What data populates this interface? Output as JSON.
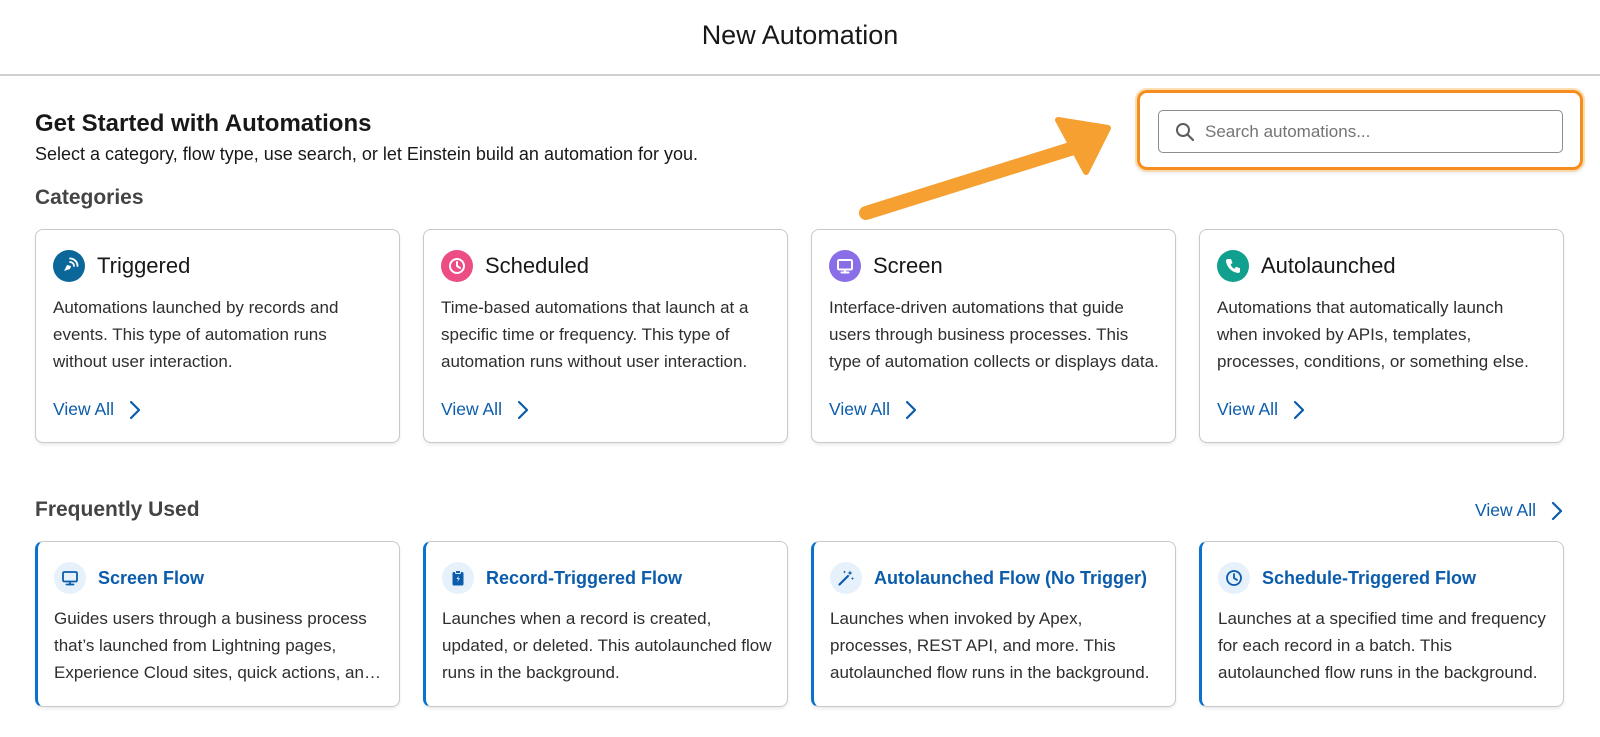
{
  "header": {
    "title": "New Automation"
  },
  "intro": {
    "title": "Get Started with Automations",
    "subtitle": "Select a category, flow type, use search, or let Einstein build an automation for you."
  },
  "search": {
    "placeholder": "Search automations..."
  },
  "colors": {
    "highlight": "#f58e1f",
    "link": "#0b5cab",
    "triggered": "#0b6699",
    "scheduled": "#ec4d85",
    "screen": "#8a6ee8",
    "autolaunched": "#12a08e"
  },
  "categories": {
    "title": "Categories",
    "items": [
      {
        "title": "Triggered",
        "icon": "signal-hand-icon",
        "description": "Automations launched by records and events. This type of automation runs without user interaction.",
        "link": "View All"
      },
      {
        "title": "Scheduled",
        "icon": "clock-icon",
        "description": "Time-based automations that launch at a specific time or frequency. This type of automation runs without user interaction.",
        "link": "View All"
      },
      {
        "title": "Screen",
        "icon": "monitor-icon",
        "description": "Interface-driven automations that guide users through business processes. This type of automation collects or displays data.",
        "link": "View All"
      },
      {
        "title": "Autolaunched",
        "icon": "phone-icon",
        "description": "Automations that automatically launch when invoked by APIs, templates, processes, conditions, or something else.",
        "link": "View All"
      }
    ]
  },
  "frequently_used": {
    "title": "Frequently Used",
    "view_all": "View All",
    "items": [
      {
        "title": "Screen Flow",
        "icon": "monitor-icon",
        "description": "Guides users through a business process that’s launched from Lightning pages, Experience Cloud sites, quick actions, and more."
      },
      {
        "title": "Record-Triggered Flow",
        "icon": "clipboard-icon",
        "description": "Launches when a record is created, updated, or deleted. This autolaunched flow runs in the background."
      },
      {
        "title": "Autolaunched Flow (No Trigger)",
        "icon": "magic-wand-icon",
        "description": "Launches when invoked by Apex, processes, REST API, and more. This autolaunched flow runs in the background."
      },
      {
        "title": "Schedule-Triggered Flow",
        "icon": "clock-icon",
        "description": "Launches at a specified time and frequency for each record in a batch. This autolaunched flow runs in the background."
      }
    ]
  }
}
